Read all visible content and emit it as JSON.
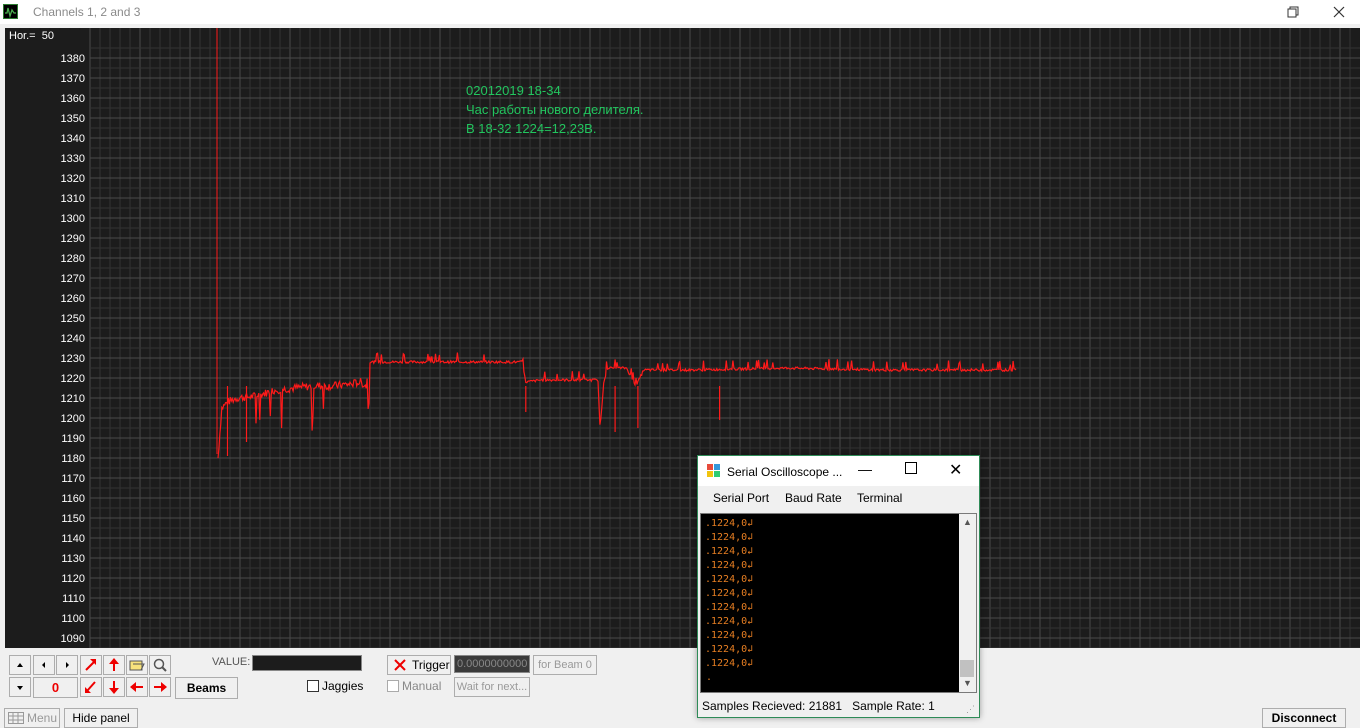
{
  "window": {
    "title": "Channels 1, 2 and 3",
    "minimize": "—",
    "maximize": "❐",
    "close": "✕"
  },
  "scope": {
    "hor_label": "Hor.=  50",
    "note_lines": [
      "02012019 18-34",
      "Час работы нового делителя.",
      "В 18-32 1224=12,23В."
    ],
    "trace_color": "#ff1a1a",
    "note_color": "#22c55e",
    "y_ticks": [
      1380,
      1370,
      1360,
      1350,
      1340,
      1330,
      1320,
      1310,
      1300,
      1290,
      1280,
      1270,
      1260,
      1250,
      1240,
      1230,
      1220,
      1210,
      1200,
      1190,
      1180,
      1170,
      1160,
      1150,
      1140,
      1130,
      1120,
      1110,
      1100,
      1090
    ]
  },
  "chart_data": {
    "type": "line",
    "title": "",
    "xlabel": "",
    "ylabel": "",
    "ylim": [
      1085,
      1389
    ],
    "grid": true,
    "series": [
      {
        "name": "",
        "color": "#ff1a1a",
        "points": [
          [
            0,
            1180
          ],
          [
            2,
            1205
          ],
          [
            5,
            1208
          ],
          [
            10,
            1210
          ],
          [
            20,
            1211
          ],
          [
            30,
            1214
          ],
          [
            40,
            1215
          ],
          [
            50,
            1216
          ],
          [
            60,
            1216
          ],
          [
            70,
            1217
          ],
          [
            75,
            1218
          ],
          [
            78,
            1216
          ],
          [
            80,
            1228
          ],
          [
            100,
            1228
          ],
          [
            130,
            1228
          ],
          [
            160,
            1228
          ],
          [
            162,
            1218
          ],
          [
            170,
            1219
          ],
          [
            190,
            1219
          ],
          [
            200,
            1219
          ],
          [
            201,
            1193
          ],
          [
            203,
            1218
          ],
          [
            205,
            1225
          ],
          [
            215,
            1225
          ],
          [
            220,
            1216
          ],
          [
            224,
            1224
          ],
          [
            250,
            1224
          ],
          [
            300,
            1225
          ],
          [
            350,
            1224
          ],
          [
            400,
            1224
          ],
          [
            420,
            1224
          ]
        ]
      }
    ]
  },
  "controls": {
    "counter": "0",
    "beams": "Beams",
    "value_label": "VALUE:",
    "jaggies": "Jaggies",
    "trigger": "Trigger",
    "trigger_value": "0.0000000000",
    "for_beam": "for Beam 0",
    "manual": "Manual",
    "wait_next": "Wait for next...",
    "menu": "Menu",
    "hide_panel": "Hide panel",
    "disconnect": "Disconnect"
  },
  "serial": {
    "title": "Serial Oscilloscope ...",
    "menu": [
      "Serial Port",
      "Baud Rate",
      "Terminal"
    ],
    "lines": [
      ".1224,0↲",
      ".1224,0↲",
      ".1224,0↲",
      ".1224,0↲",
      ".1224,0↲",
      ".1224,0↲",
      ".1224,0↲",
      ".1224,0↲",
      ".1224,0↲",
      ".1224,0↲",
      ".1224,0↲"
    ],
    "cursor_line": ".",
    "status_samples": "Samples Recieved: 21881",
    "status_rate": "Sample Rate: 1"
  }
}
